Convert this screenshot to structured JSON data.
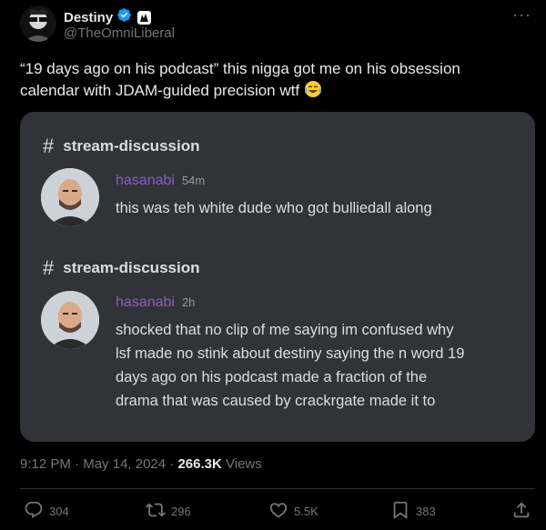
{
  "author": {
    "display_name": "Destiny",
    "handle": "@TheOmniLiberal"
  },
  "tweet": {
    "text": "“19 days ago on his podcast” this nigga got me on his obsession calendar with JDAM-guided precision wtf",
    "emoji": "😂"
  },
  "embed": {
    "messages": [
      {
        "channel": "stream-discussion",
        "user": "hasanabi",
        "time": "54m",
        "text": "this was teh white dude who got bulliedall along"
      },
      {
        "channel": "stream-discussion",
        "user": "hasanabi",
        "time": "2h",
        "lines": [
          "shocked that no clip of me saying im confused why",
          "lsf made no stink about destiny saying the n word 19",
          "days ago on his podcast made a fraction of the",
          "drama that was caused by crackrgate made it to"
        ]
      }
    ]
  },
  "meta": {
    "time": "9:12 PM",
    "separator": "·",
    "date": "May 14, 2024",
    "views_count": "266.3K",
    "views_label": "Views"
  },
  "actions": {
    "replies": "304",
    "reposts": "296",
    "likes": "5.5K",
    "bookmarks": "383"
  },
  "colors": {
    "background": "#000000",
    "card": "#313338",
    "username": "#8e5cc4",
    "verified": "#1d9bf0",
    "muted": "#71767b"
  }
}
